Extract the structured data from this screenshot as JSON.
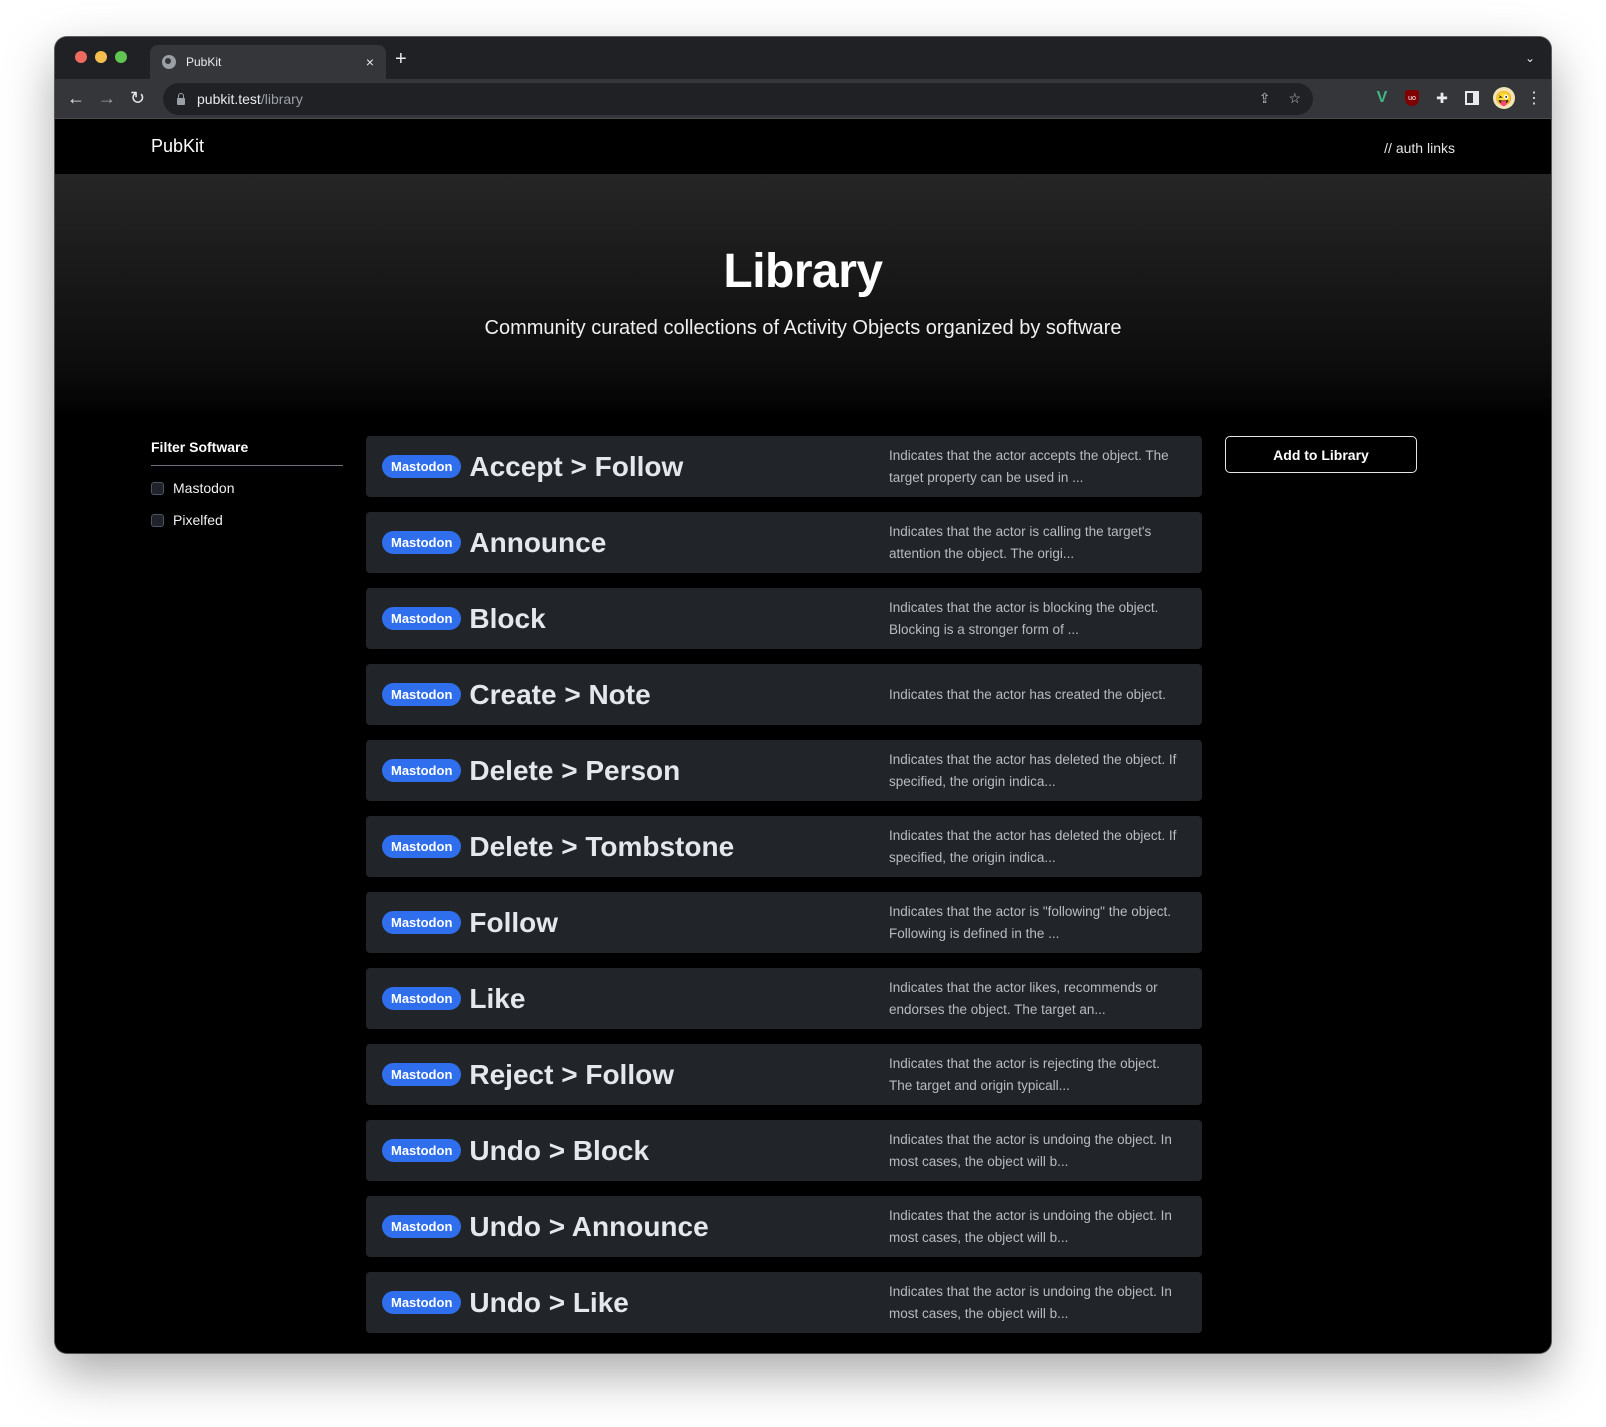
{
  "browser": {
    "tab_title": "PubKit",
    "url_host": "pubkit.test",
    "url_path": "/library",
    "new_tab_label": "+",
    "close_tab_label": "×"
  },
  "header": {
    "brand": "PubKit",
    "auth_links": "// auth links"
  },
  "hero": {
    "title": "Library",
    "subtitle": "Community curated collections of Activity Objects organized by software"
  },
  "sidebar": {
    "heading": "Filter Software",
    "filters": [
      {
        "label": "Mastodon",
        "checked": false
      },
      {
        "label": "Pixelfed",
        "checked": false
      }
    ]
  },
  "actions": {
    "add_label": "Add to Library"
  },
  "items": [
    {
      "software": "Mastodon",
      "title": "Accept > Follow",
      "description": "Indicates that the actor accepts the object. The target property can be used in ..."
    },
    {
      "software": "Mastodon",
      "title": "Announce",
      "description": "Indicates that the actor is calling the target's attention the object. The origi..."
    },
    {
      "software": "Mastodon",
      "title": "Block",
      "description": "Indicates that the actor is blocking the object. Blocking is a stronger form of ..."
    },
    {
      "software": "Mastodon",
      "title": "Create > Note",
      "description": "Indicates that the actor has created the object."
    },
    {
      "software": "Mastodon",
      "title": "Delete > Person",
      "description": "Indicates that the actor has deleted the object. If specified, the origin indica..."
    },
    {
      "software": "Mastodon",
      "title": "Delete > Tombstone",
      "description": "Indicates that the actor has deleted the object. If specified, the origin indica..."
    },
    {
      "software": "Mastodon",
      "title": "Follow",
      "description": "Indicates that the actor is \"following\" the object. Following is defined in the ..."
    },
    {
      "software": "Mastodon",
      "title": "Like",
      "description": "Indicates that the actor likes, recommends or endorses the object. The target an..."
    },
    {
      "software": "Mastodon",
      "title": "Reject > Follow",
      "description": "Indicates that the actor is rejecting the object. The target and origin typicall..."
    },
    {
      "software": "Mastodon",
      "title": "Undo > Block",
      "description": "Indicates that the actor is undoing the object. In most cases, the object will b..."
    },
    {
      "software": "Mastodon",
      "title": "Undo > Announce",
      "description": "Indicates that the actor is undoing the object. In most cases, the object will b..."
    },
    {
      "software": "Mastodon",
      "title": "Undo > Like",
      "description": "Indicates that the actor is undoing the object. In most cases, the object will b..."
    }
  ],
  "colors": {
    "badge": "#2f6fee",
    "card": "#212429",
    "page_bg": "#000000"
  }
}
